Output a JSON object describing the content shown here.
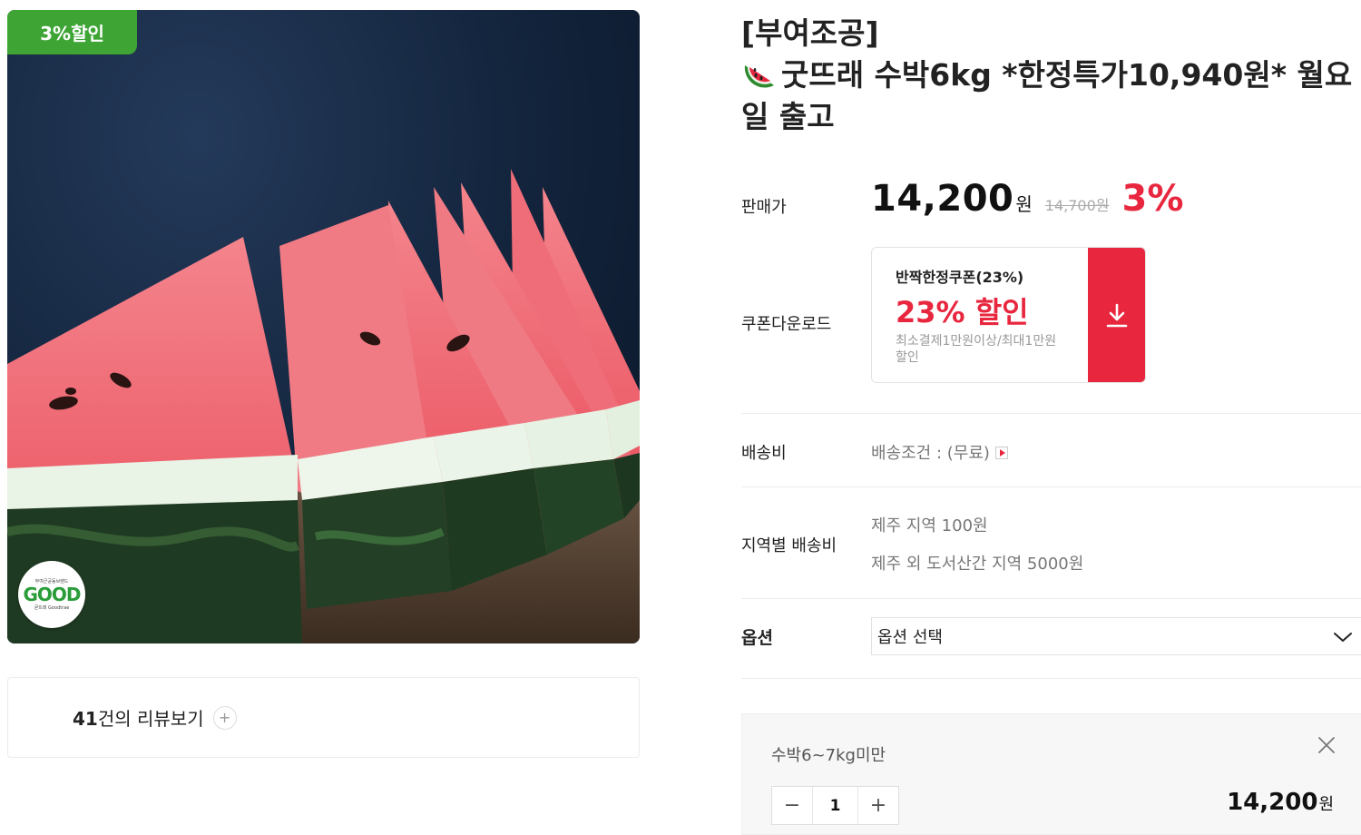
{
  "image": {
    "discount_badge": "3%할인",
    "brand_logo": {
      "top_text": "부여군공동브랜드",
      "mark": "GOOD",
      "bottom_text": "굳뜨래 Goodtrae"
    }
  },
  "reviews": {
    "count": "41",
    "label": "건의 리뷰보기",
    "plus": "+"
  },
  "product": {
    "title_line1": "[부여조공]",
    "title_line2": "굿뜨래 수박6kg *한정특가10,940원* 월요일 출고",
    "title_icon": "watermelon-icon"
  },
  "price": {
    "label": "판매가",
    "current": "14,200",
    "currency": "원",
    "original": "14,700원",
    "discount_rate": "3%"
  },
  "coupon": {
    "label": "쿠폰다운로드",
    "name": "반짝한정쿠폰(23%)",
    "rate_text": "23% 할인",
    "condition": "최소결제1만원이상/최대1만원 할인",
    "download_icon": "download-icon"
  },
  "shipping": {
    "label": "배송비",
    "value": "배송조건 : (무료)"
  },
  "regional_shipping": {
    "label": "지역별 배송비",
    "lines": [
      "제주 지역 100원",
      "제주 외 도서산간 지역 5000원"
    ]
  },
  "option": {
    "label": "옵션",
    "placeholder": "옵션 선택"
  },
  "selected_option": {
    "name": "수박6~7kg미만",
    "quantity": "1",
    "minus": "−",
    "plus": "+",
    "total": "14,200",
    "currency": "원"
  },
  "colors": {
    "accent_red": "#e8273f",
    "badge_green": "#3ea535"
  }
}
